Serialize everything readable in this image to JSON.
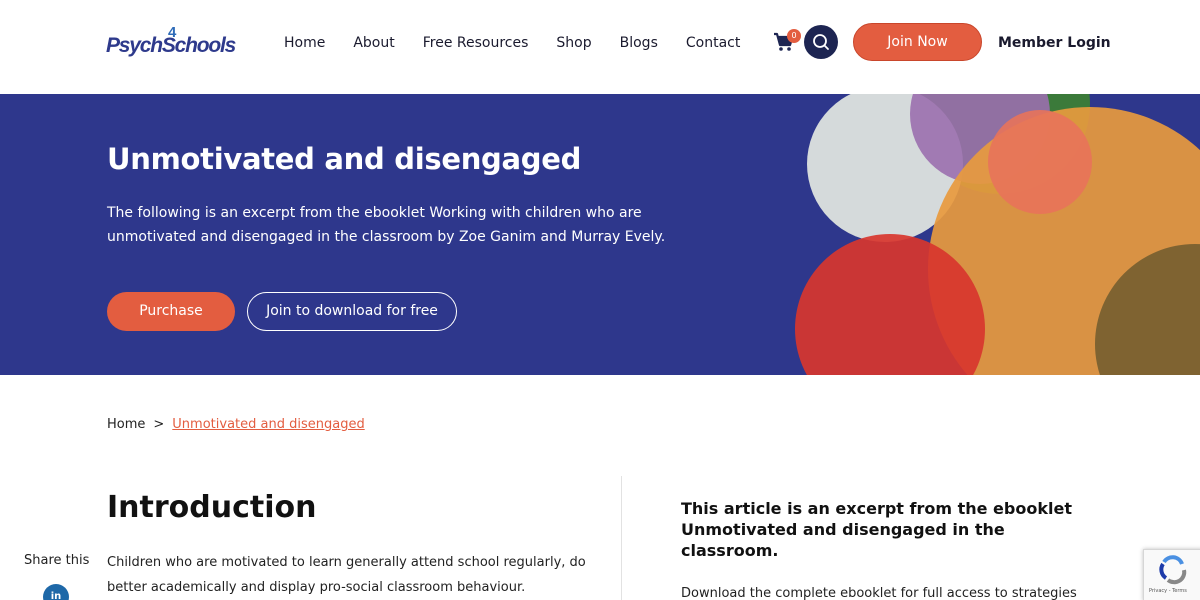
{
  "header": {
    "logo_text": "Psych",
    "logo_four": "4",
    "logo_text2": "Schools",
    "nav": [
      "Home",
      "About",
      "Free Resources",
      "Shop",
      "Blogs",
      "Contact"
    ],
    "cart_count": "0",
    "join_label": "Join Now",
    "member_login_label": "Member Login"
  },
  "hero": {
    "title": "Unmotivated and disengaged",
    "description": "The following is an excerpt from the ebooklet Working with children who are unmotivated and disengaged in the classroom by Zoe Ganim and Murray Evely.",
    "purchase_label": "Purchase",
    "join_free_label": "Join to download for free",
    "colors": {
      "background": "#2e378c",
      "circle_grey": "#d5dadb",
      "circle_purple": "#9b6fae",
      "circle_green": "#3b7a3a",
      "circle_orange": "#e89a3e",
      "circle_salmon": "#e8735a",
      "circle_red": "#d8362e",
      "circle_olive": "#6e5a2e"
    }
  },
  "breadcrumb": {
    "home": "Home",
    "separator": ">",
    "current": "Unmotivated and disengaged"
  },
  "content": {
    "intro_title": "Introduction",
    "intro_text": "Children who are motivated to learn generally attend school regularly, do better academically and display pro-social classroom behaviour.",
    "share_label": "Share this",
    "linkedin_icon": "in",
    "side_title": "This article is an excerpt from the ebooklet Unmotivated and disengaged in the classroom.",
    "side_text": "Download the complete ebooklet for full access to strategies"
  },
  "recaptcha": {
    "footer": "Privacy - Terms"
  },
  "accent_color": "#e35d40"
}
